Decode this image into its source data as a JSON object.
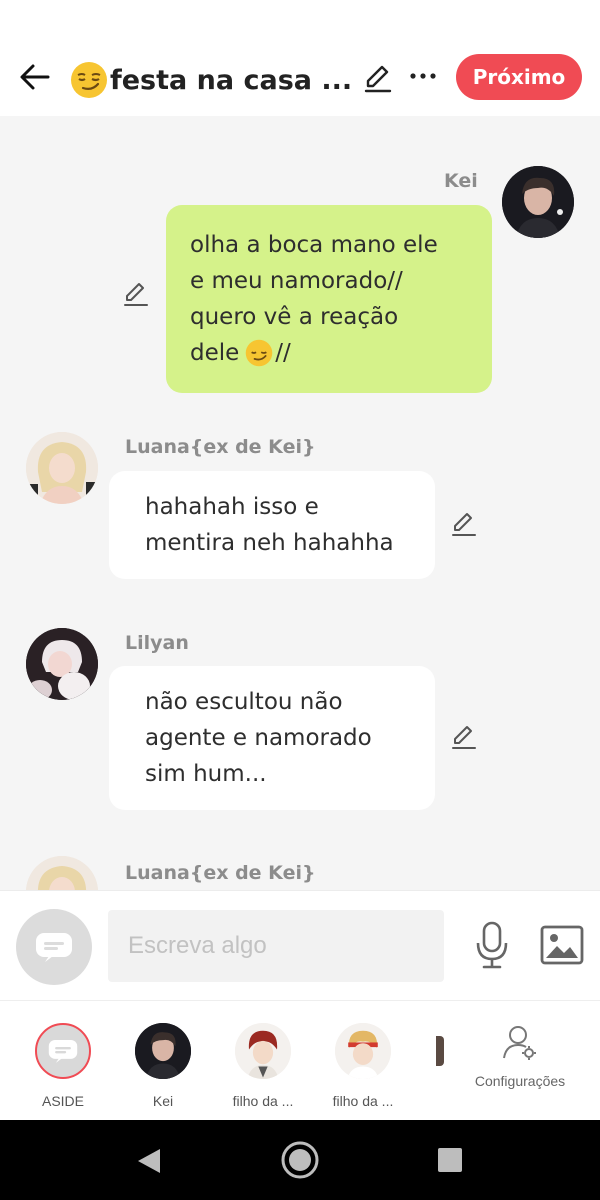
{
  "header": {
    "title": "festa na casa ...",
    "title_emoji": "smirk-emoji",
    "next_label": "Próximo",
    "accent_color": "#f04b54"
  },
  "messages": [
    {
      "sender": "Kei",
      "side": "right",
      "lines": [
        "olha a boca mano ele",
        "e meu namorado//",
        "quero vê a reação",
        "dele"
      ],
      "trailing": "//",
      "bubble_color": "#d5f28a"
    },
    {
      "sender": "Luana{ex de Kei}",
      "side": "left",
      "lines": [
        "hahahah isso e",
        "mentira neh hahahha"
      ]
    },
    {
      "sender": "Lilyan",
      "side": "left",
      "lines": [
        "não escultou não",
        "agente e namorado",
        "sim hum..."
      ]
    },
    {
      "sender": "Luana{ex de Kei}",
      "side": "left",
      "lines": []
    }
  ],
  "composer": {
    "placeholder": "Escreva algo"
  },
  "characters": [
    {
      "label": "ASIDE",
      "icon": "aside-icon"
    },
    {
      "label": "Kei",
      "icon": "avatar-kei"
    },
    {
      "label": "filho da ...",
      "icon": "avatar-filho-1"
    },
    {
      "label": "filho da ...",
      "icon": "avatar-filho-2"
    }
  ],
  "settings_label": "Configurações"
}
